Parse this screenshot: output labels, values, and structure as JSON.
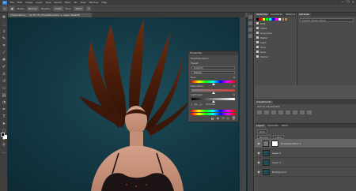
{
  "menubar": {
    "logo": "Ps",
    "items": [
      "File",
      "Edit",
      "Image",
      "Layer",
      "Type",
      "Select",
      "Filter",
      "3D",
      "View",
      "Window",
      "Help"
    ],
    "window_controls": [
      "—",
      "❐",
      "✕"
    ]
  },
  "options": {
    "mode_label": "Mode:",
    "mode_value": "Normal",
    "opacity_label": "Opacity:",
    "opacity_value": "100%",
    "flow_label": "Flow:",
    "flow_value": "100%"
  },
  "document": {
    "tab_title": "shutterstock_... @ 16.7% (Hue/Saturation 1, Layer Mask/8)"
  },
  "properties": {
    "title": "Properties",
    "layer_type": "Hue/Saturation",
    "preset_label": "Preset:",
    "preset_value": "Custom",
    "channel_value": "Master",
    "hue_label": "Hue:",
    "hue_value": "0",
    "saturation_label": "Saturation:",
    "saturation_value": "0",
    "lightness_label": "Lightness:",
    "lightness_value": "0",
    "colorize_label": "Colorize",
    "hue_level": 0.5,
    "saturation_level": 0.5,
    "lightness_level": 0.5
  },
  "swatches": {
    "tabs": [
      "Swatches",
      "Gradients",
      "Patterns"
    ],
    "colors": [
      "#000000",
      "#ff0000",
      "#ffff00",
      "#00ff00",
      "#00ffff",
      "#0000ff",
      "#ff00ff",
      "#ffffff",
      "#808080",
      "#c08040"
    ],
    "folders": [
      "RGB",
      "CMYK",
      "Grayscale",
      "Pastel",
      "Light",
      "Pure",
      "Dark",
      "Darker"
    ]
  },
  "libraries": {
    "title": "Libraries",
    "search_placeholder": "Search Adobe Stock"
  },
  "adjustments": {
    "title": "Adjustments",
    "subtitle": "Add an adjustment"
  },
  "layers": {
    "tabs": [
      "Layers",
      "Channels",
      "Paths"
    ],
    "kind_label": "Kind",
    "blend_value": "Normal",
    "opacity_value": "100%",
    "rows": [
      {
        "name": "Hue/Saturation 1",
        "kind": "adjustment",
        "selected": true
      },
      {
        "name": "Layer 2",
        "kind": "pixel",
        "selected": false
      },
      {
        "name": "Layer 1",
        "kind": "pixel",
        "selected": false
      },
      {
        "name": "Background",
        "kind": "pixel",
        "selected": false
      }
    ]
  }
}
